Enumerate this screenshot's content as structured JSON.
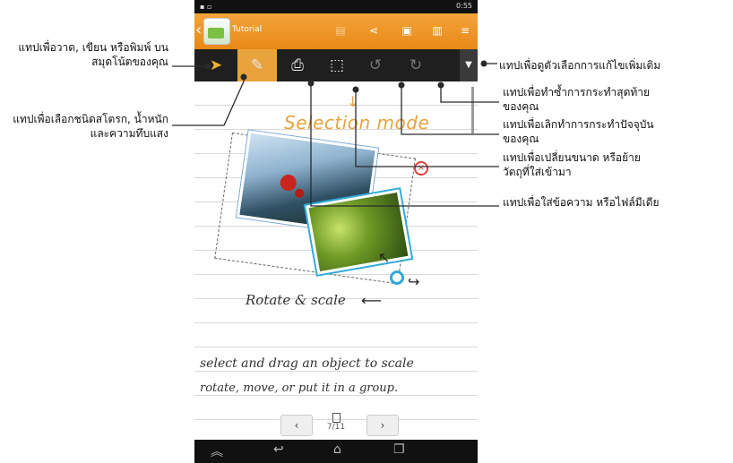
{
  "statusbar": {
    "time": "0:55"
  },
  "appbar": {
    "title": "Tutorial"
  },
  "toolbar": {
    "tools": [
      "draw-mode",
      "brush",
      "insert",
      "selection",
      "undo",
      "redo"
    ]
  },
  "canvas": {
    "selection_mode": "Selection mode",
    "rotate_scale": "Rotate & scale",
    "hand_line1": "select and drag an object to scale",
    "hand_line2": "rotate, move, or put it in a group."
  },
  "pager": {
    "page": "7/11",
    "prev": "‹",
    "next": "›"
  },
  "annotations": {
    "write": "แทปเพื่อวาด, เขียน หรือพิมพ์ บนสมุดโน้ตของคุณ",
    "stroke": "แทปเพื่อเลือกชนิดสโตรก, น้ำหนัก และความทึบแสง",
    "more": "แทปเพื่อดูตัวเลือกการแก้ไขเพิ่มเติม",
    "redo": "แทปเพื่อทำซ้ำการกระทำสุดท้ายของคุณ",
    "undo": "แทปเพื่อเลิกทำการกระทำปัจจุบันของคุณ",
    "resize": "แทปเพื่อเปลี่ยนขนาด หรือย้ายวัตถุที่ใส่เข้ามา",
    "insert": "แทปเพื่อใส่ข้อความ หรือไฟล์มีเดีย"
  }
}
